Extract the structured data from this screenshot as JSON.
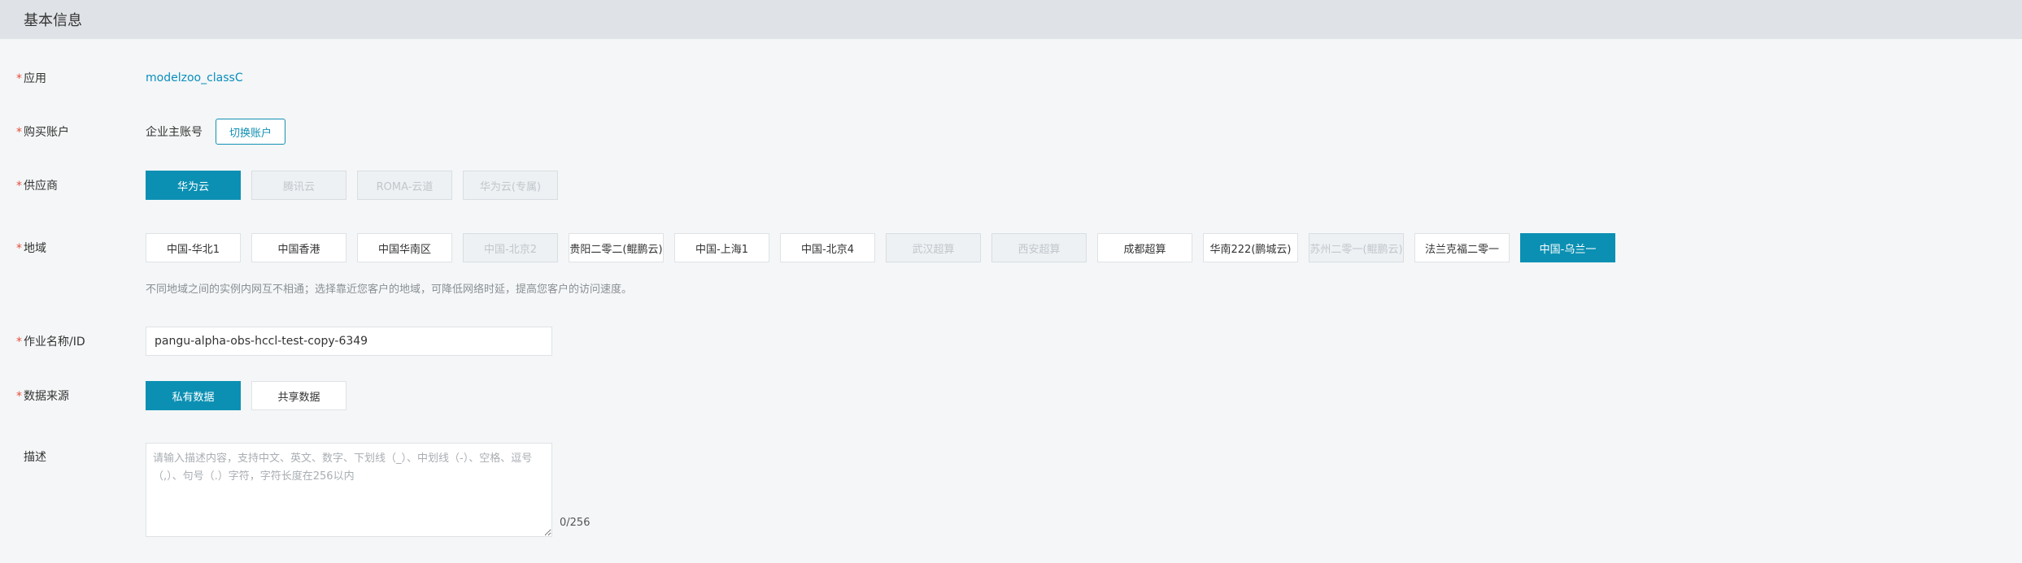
{
  "header": {
    "title": "基本信息"
  },
  "app_row": {
    "label": "应用",
    "value": "modelzoo_classC"
  },
  "account_row": {
    "label": "购买账户",
    "value": "企业主账号",
    "switch_label": "切换账户"
  },
  "vendor_row": {
    "label": "供应商",
    "options": [
      {
        "label": "华为云",
        "state": "selected"
      },
      {
        "label": "腾讯云",
        "state": "disabled"
      },
      {
        "label": "ROMA-云道",
        "state": "disabled"
      },
      {
        "label": "华为云(专属)",
        "state": "disabled"
      }
    ]
  },
  "region_row": {
    "label": "地域",
    "options": [
      {
        "label": "中国-华北1",
        "state": "normal"
      },
      {
        "label": "中国香港",
        "state": "normal"
      },
      {
        "label": "中国华南区",
        "state": "normal"
      },
      {
        "label": "中国-北京2",
        "state": "disabled"
      },
      {
        "label": "贵阳二零二(鲲鹏云)",
        "state": "normal"
      },
      {
        "label": "中国-上海1",
        "state": "normal"
      },
      {
        "label": "中国-北京4",
        "state": "normal"
      },
      {
        "label": "武汉超算",
        "state": "disabled"
      },
      {
        "label": "西安超算",
        "state": "disabled"
      },
      {
        "label": "成都超算",
        "state": "normal"
      },
      {
        "label": "华南222(鹏城云)",
        "state": "normal"
      },
      {
        "label": "苏州二零一(鲲鹏云)",
        "state": "disabled"
      },
      {
        "label": "法兰克福二零一",
        "state": "normal"
      },
      {
        "label": "中国-乌兰一",
        "state": "selected"
      }
    ],
    "hint": "不同地域之间的实例内网互不相通；选择靠近您客户的地域，可降低网络时延，提高您客户的访问速度。"
  },
  "job_row": {
    "label": "作业名称/ID",
    "value": "pangu-alpha-obs-hccl-test-copy-6349"
  },
  "source_row": {
    "label": "数据来源",
    "options": [
      {
        "label": "私有数据",
        "state": "selected"
      },
      {
        "label": "共享数据",
        "state": "normal"
      }
    ]
  },
  "desc_row": {
    "label": "描述",
    "placeholder": "请输入描述内容，支持中文、英文、数字、下划线（_）、中划线（-）、空格、逗号（,）、句号（.）字符，字符长度在256以内",
    "counter": "0/256"
  },
  "colors": {
    "accent": "#0b90b3",
    "required": "#e74c3c",
    "header_bg": "#dfe3e7",
    "page_bg": "#f4f6f7"
  }
}
